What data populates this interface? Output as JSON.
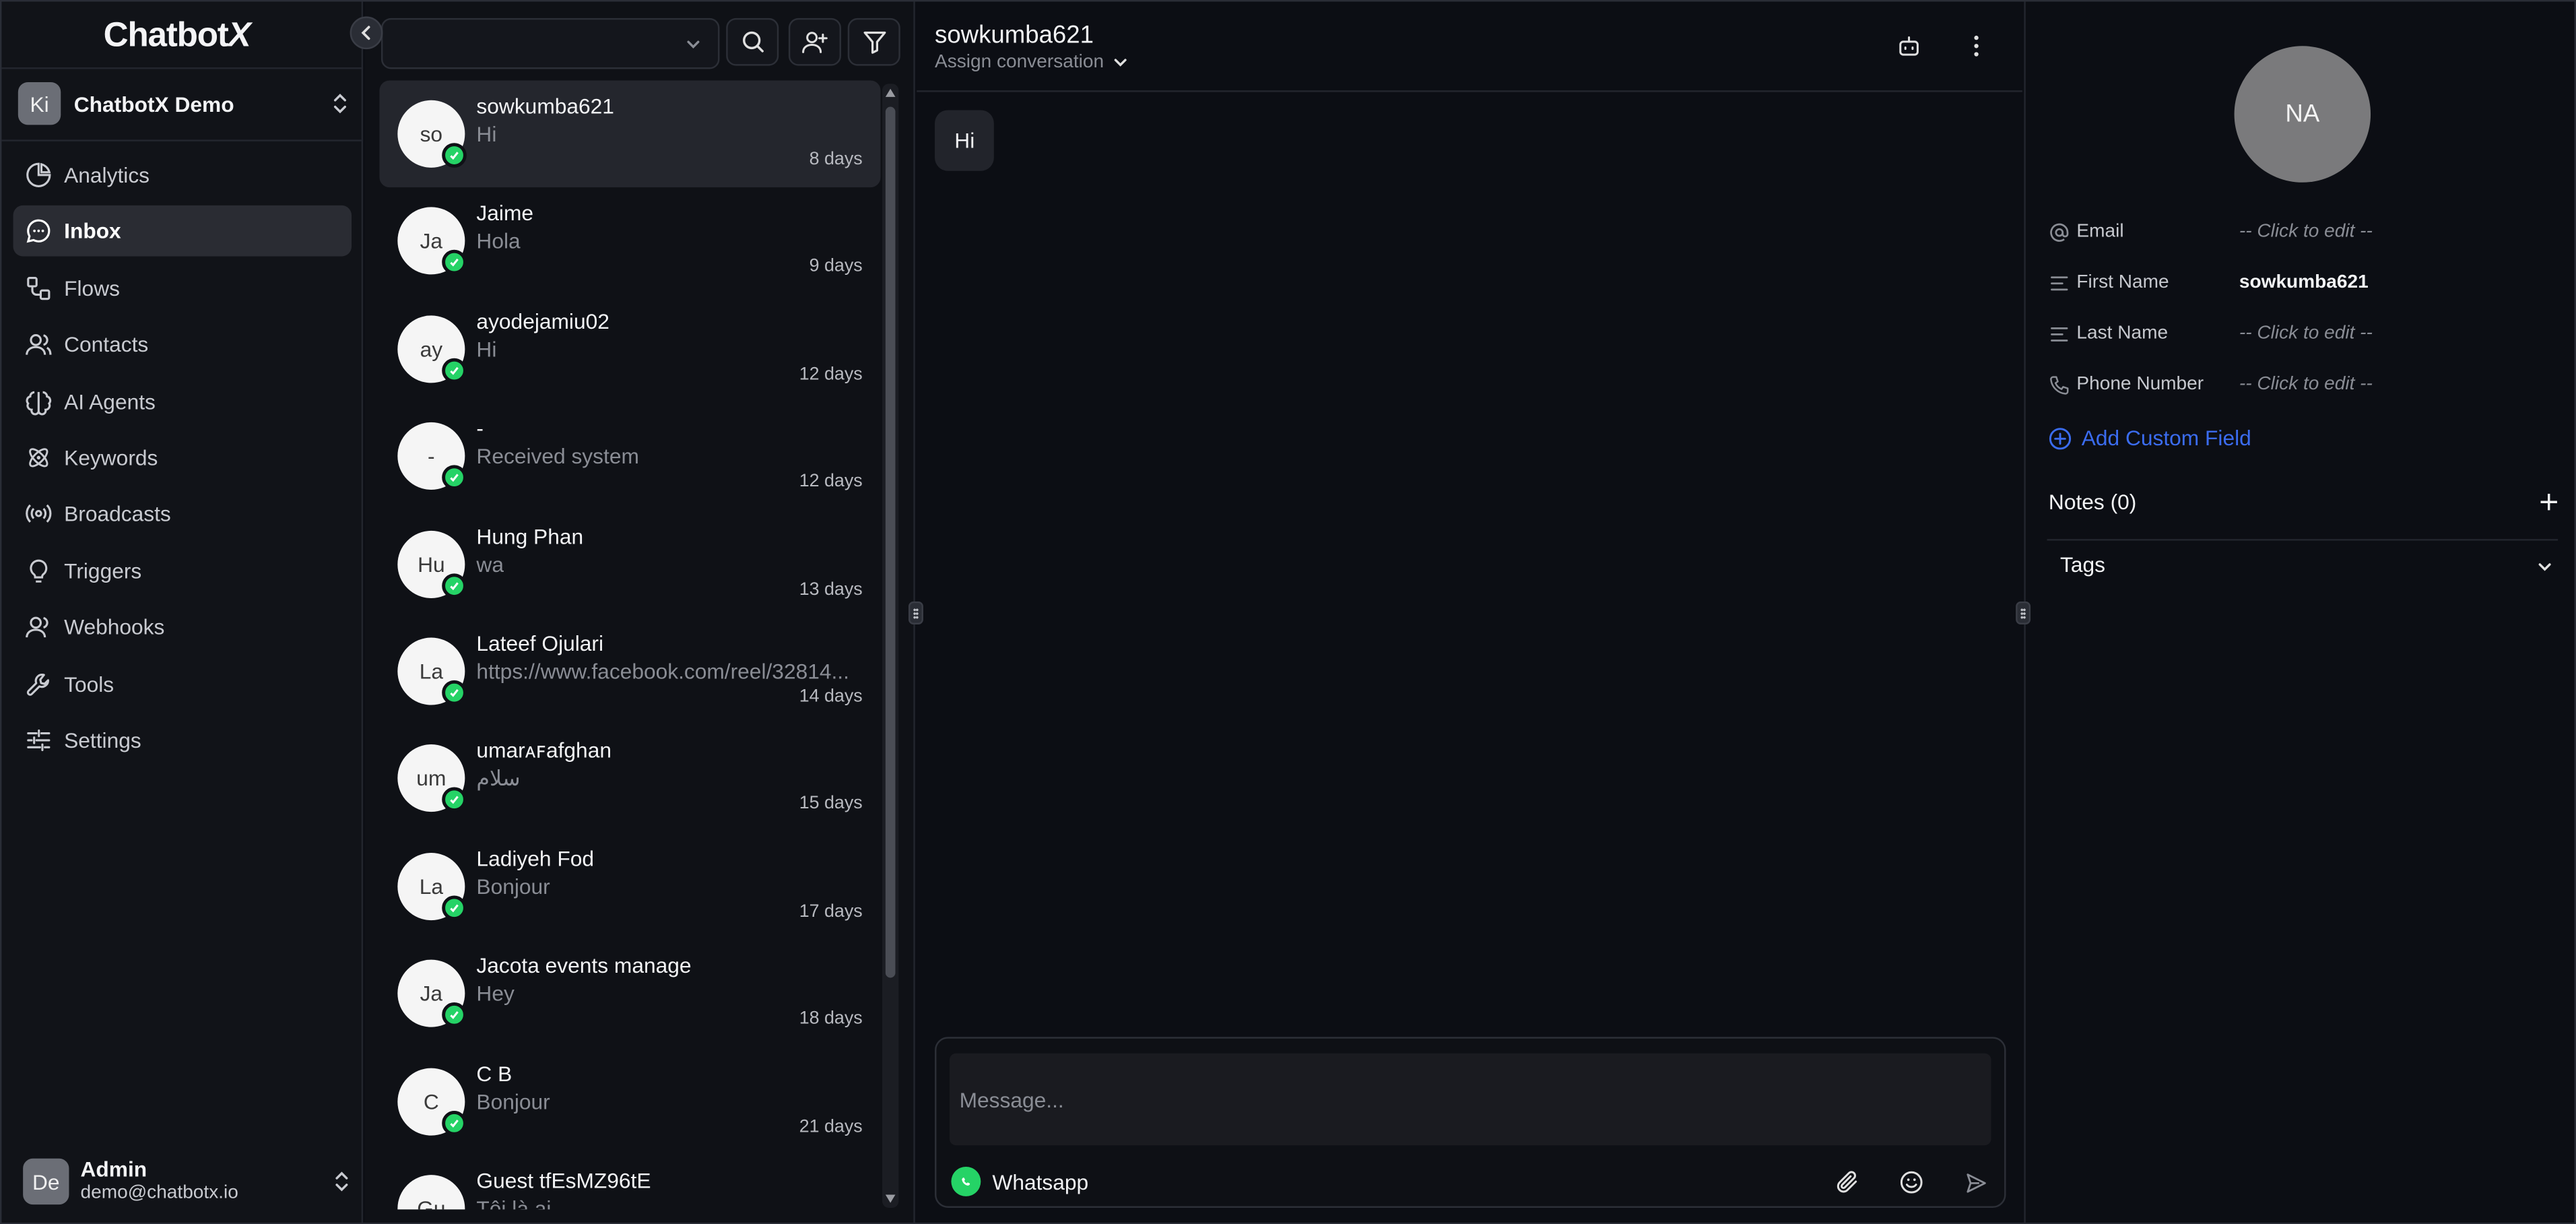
{
  "app": {
    "logo_main": "Chatbot",
    "logo_x": "X"
  },
  "workspace": {
    "avatar": "Ki",
    "name": "ChatbotX Demo"
  },
  "nav": [
    {
      "label": "Analytics",
      "icon": "pie-chart-icon"
    },
    {
      "label": "Inbox",
      "icon": "chat-bubble-icon",
      "active": true
    },
    {
      "label": "Flows",
      "icon": "flow-icon"
    },
    {
      "label": "Contacts",
      "icon": "users-icon"
    },
    {
      "label": "AI Agents",
      "icon": "brain-icon"
    },
    {
      "label": "Keywords",
      "icon": "atom-icon"
    },
    {
      "label": "Broadcasts",
      "icon": "broadcast-icon"
    },
    {
      "label": "Triggers",
      "icon": "lightbulb-icon"
    },
    {
      "label": "Webhooks",
      "icon": "webhook-icon"
    },
    {
      "label": "Tools",
      "icon": "wrench-icon"
    },
    {
      "label": "Settings",
      "icon": "sliders-icon"
    }
  ],
  "user": {
    "avatar": "De",
    "name": "Admin",
    "email": "demo@chatbotx.io"
  },
  "conversations": [
    {
      "initials": "so",
      "name": "sowkumba621",
      "preview": "Hi",
      "time": "8 days",
      "active": true
    },
    {
      "initials": "Ja",
      "name": "Jaime",
      "preview": "Hola",
      "time": "9 days"
    },
    {
      "initials": "ay",
      "name": "ayodejamiu02",
      "preview": "Hi",
      "time": "12 days"
    },
    {
      "initials": "-",
      "name": "-",
      "preview": "Received system",
      "time": "12 days"
    },
    {
      "initials": "Hu",
      "name": "Hung Phan",
      "preview": "wa",
      "time": "13 days"
    },
    {
      "initials": "La",
      "name": "Lateef Ojulari",
      "preview": "https://www.facebook.com/reel/32814...",
      "time": "14 days"
    },
    {
      "initials": "um",
      "name": "umarᴀꜰafghan",
      "preview": "سلام",
      "time": "15 days"
    },
    {
      "initials": "La",
      "name": "Ladiyeh Fod",
      "preview": "Bonjour",
      "time": "17 days"
    },
    {
      "initials": "Ja",
      "name": "Jacota events manage",
      "preview": "Hey",
      "time": "18 days"
    },
    {
      "initials": "C",
      "name": "C B",
      "preview": "Bonjour",
      "time": "21 days"
    },
    {
      "initials": "Gu",
      "name": "Guest tfEsMZ96tE",
      "preview": "Tôi là ai",
      "time": ""
    }
  ],
  "chat": {
    "title": "sowkumba621",
    "assign_label": "Assign conversation",
    "messages": [
      {
        "text": "Hi",
        "direction": "incoming"
      }
    ],
    "composer_placeholder": "Message...",
    "channel": "Whatsapp"
  },
  "contact": {
    "avatar": "NA",
    "fields": [
      {
        "label": "Email",
        "value": "-- Click to edit --",
        "icon": "at-icon",
        "set": false
      },
      {
        "label": "First Name",
        "value": "sowkumba621",
        "icon": "text-lines-icon",
        "set": true
      },
      {
        "label": "Last Name",
        "value": "-- Click to edit --",
        "icon": "text-lines-icon",
        "set": false
      },
      {
        "label": "Phone Number",
        "value": "-- Click to edit --",
        "icon": "phone-icon",
        "set": false
      }
    ],
    "add_field_label": "Add Custom Field",
    "notes_label": "Notes (0)",
    "tags_label": "Tags"
  },
  "colors": {
    "accent": "#3b6cf0",
    "whatsapp": "#25d366",
    "background": "#0c0e14"
  }
}
